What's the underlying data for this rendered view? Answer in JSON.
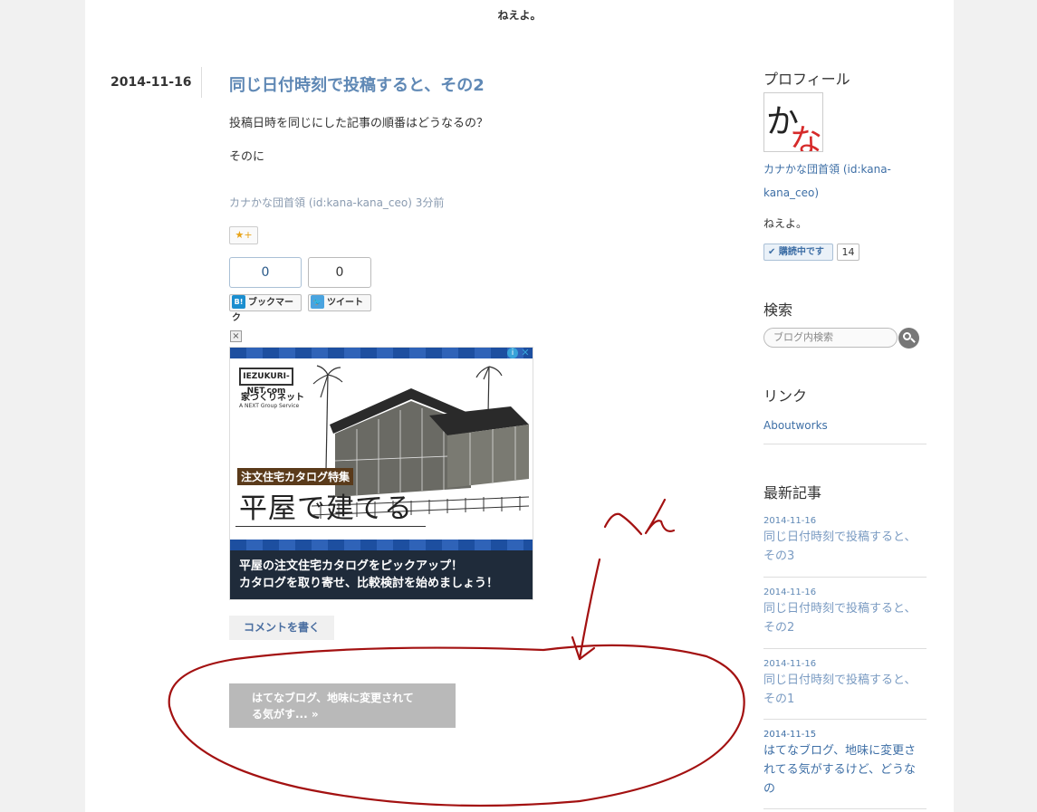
{
  "blog": {
    "tagline": "ねえよ。"
  },
  "entry": {
    "date": "2014-11-16",
    "title": "同じ日付時刻で投稿すると、その2",
    "body_1": "投稿日時を同じにした記事の順番はどうなるの？",
    "body_2": "そのに",
    "author": "カナかな団首領 (id:kana-kana_ceo)",
    "time_ago": "3分前",
    "star_label": "★+",
    "bookmark_count": "0",
    "tweet_count": "0",
    "bookmark_label": "ブックマーク",
    "tweet_label": "ツイート",
    "comment_label": "コメントを書く"
  },
  "ad": {
    "close": "×",
    "info": "i",
    "x": "✕",
    "logo_text": "IEZUKURI-NET.com",
    "logo_jp": "家づくりネット",
    "logo_sub": "A NEXT Group Service",
    "catalog_label": "注文住宅カタログ特集",
    "headline": "平屋で建てる",
    "footer_line1": "平屋の注文住宅カタログをピックアップ！",
    "footer_line2": "カタログを取り寄せ、比較検討を始めましょう！"
  },
  "pager": {
    "prev_line1": "はてなブログ、地味に変更されて",
    "prev_line2": "る気がす... »"
  },
  "annotation": {
    "text": "へん",
    "color": "#a31111"
  },
  "sidebar": {
    "profile_heading": "プロフィール",
    "avatar_char1": "か",
    "avatar_char2": "な",
    "profile_name": "カナかな団首領 (id:kana-kana_ceo)",
    "profile_desc": "ねえよ。",
    "subscribe_label": "✔ 購読中です",
    "subscribe_count": "14",
    "search_heading": "検索",
    "search_placeholder": "ブログ内検索",
    "links_heading": "リンク",
    "link_1": "Aboutworks",
    "recent_heading": "最新記事",
    "recent": [
      {
        "date": "2014-11-16",
        "title": "同じ日付時刻で投稿すると、その3"
      },
      {
        "date": "2014-11-16",
        "title": "同じ日付時刻で投稿すると、その2"
      },
      {
        "date": "2014-11-16",
        "title": "同じ日付時刻で投稿すると、その1"
      },
      {
        "date": "2014-11-15",
        "title": "はてなブログ、地味に変更されてる気がするけど、どうなの"
      }
    ]
  }
}
